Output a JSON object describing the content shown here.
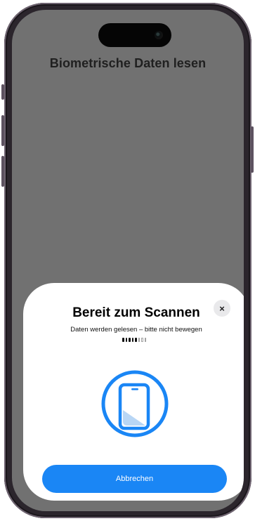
{
  "screen": {
    "title": "Biometrische Daten lesen"
  },
  "scan_sheet": {
    "title": "Bereit zum Scannen",
    "subtitle": "Daten werden gelesen – bitte nicht bewegen",
    "progress": {
      "filled": 5,
      "total": 8
    },
    "close_icon_glyph": "×",
    "cancel_label": "Abbrechen",
    "illustration": "phone-in-circle-icon"
  },
  "colors": {
    "accent": "#1a86f5",
    "dimmed_background": "#717171",
    "sheet_background": "#ffffff"
  }
}
